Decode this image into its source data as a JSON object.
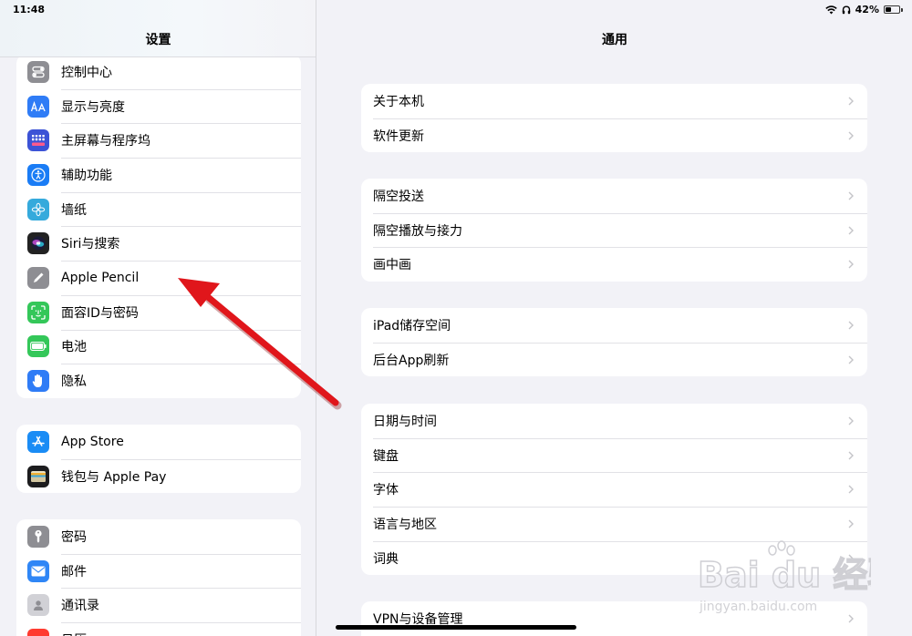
{
  "status_bar": {
    "time": "11:48",
    "battery": "42%",
    "battery_level": 0.42
  },
  "sidebar": {
    "title": "设置",
    "groups": [
      {
        "items": [
          {
            "label": "控制中心",
            "icon": "control-center-icon",
            "color": "#8e8e93"
          },
          {
            "label": "显示与亮度",
            "icon": "display-brightness-icon",
            "color": "#2f7cf6"
          },
          {
            "label": "主屏幕与程序坞",
            "icon": "home-screen-dock-icon",
            "color": "#3c53d6"
          },
          {
            "label": "辅助功能",
            "icon": "accessibility-icon",
            "color": "#1a7cf5"
          },
          {
            "label": "墙纸",
            "icon": "wallpaper-icon",
            "color": "#35aadc"
          },
          {
            "label": "Siri与搜索",
            "icon": "siri-icon",
            "color": "#222222"
          },
          {
            "label": "Apple Pencil",
            "icon": "pencil-icon",
            "color": "#8e8e93"
          },
          {
            "label": "面容ID与密码",
            "icon": "face-id-icon",
            "color": "#34c759"
          },
          {
            "label": "电池",
            "icon": "battery-icon",
            "color": "#34c759"
          },
          {
            "label": "隐私",
            "icon": "privacy-hand-icon",
            "color": "#2f7cf6"
          }
        ]
      },
      {
        "items": [
          {
            "label": "App Store",
            "icon": "app-store-icon",
            "color": "#1a8cf5"
          },
          {
            "label": "钱包与 Apple Pay",
            "icon": "wallet-icon",
            "color": "#1c1c1e"
          }
        ]
      },
      {
        "items": [
          {
            "label": "密码",
            "icon": "key-icon",
            "color": "#8e8e93"
          },
          {
            "label": "邮件",
            "icon": "mail-icon",
            "color": "#2f86f6"
          },
          {
            "label": "通讯录",
            "icon": "contacts-icon",
            "color": "#d1d1d6"
          },
          {
            "label": "日历",
            "icon": "calendar-icon",
            "color": "#ff3b30"
          }
        ]
      }
    ]
  },
  "main": {
    "title": "通用",
    "groups": [
      {
        "items": [
          {
            "label": "关于本机"
          },
          {
            "label": "软件更新"
          }
        ]
      },
      {
        "items": [
          {
            "label": "隔空投送"
          },
          {
            "label": "隔空播放与接力"
          },
          {
            "label": "画中画"
          }
        ]
      },
      {
        "items": [
          {
            "label": "iPad储存空间"
          },
          {
            "label": "后台App刷新"
          }
        ]
      },
      {
        "items": [
          {
            "label": "日期与时间"
          },
          {
            "label": "键盘"
          },
          {
            "label": "字体"
          },
          {
            "label": "语言与地区"
          },
          {
            "label": "词典"
          }
        ]
      },
      {
        "items": [
          {
            "label": "VPN与设备管理"
          }
        ]
      }
    ]
  },
  "annotation": {
    "arrow_color": "#e0161b"
  },
  "watermark": {
    "brand": "Bai du 经验",
    "url": "jingyan.baidu.com"
  }
}
